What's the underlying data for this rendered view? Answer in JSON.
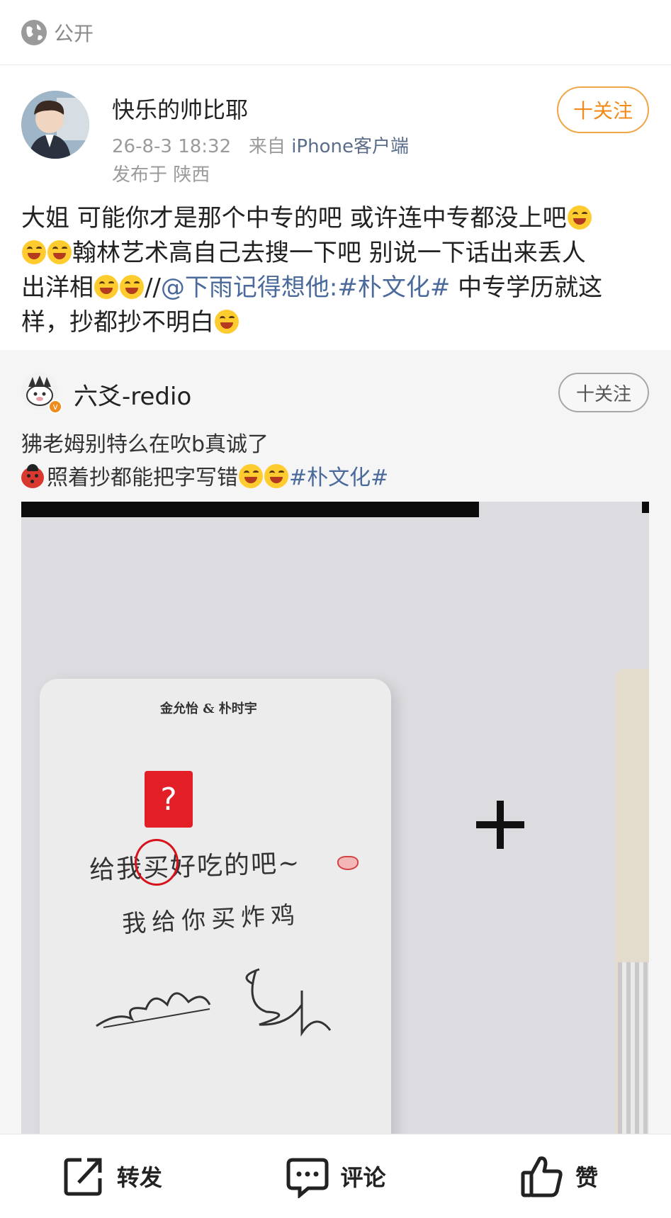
{
  "visibility": {
    "label": "公开",
    "icon": "globe-icon"
  },
  "author": {
    "name": "快乐的帅比耶",
    "time": "26-8-3 18:32",
    "source_prefix": "来自",
    "source": "iPhone客户端",
    "location": "发布于 陕西",
    "follow_label": "十关注"
  },
  "post": {
    "line1": "大姐 可能你才是那个中专的吧 或许连中专都没上吧",
    "line2": "翰林艺术高自己去搜一下吧 别说一下话出来丢人",
    "line3_start": "出洋相",
    "line3_sep": "//",
    "mention": "@下雨记得想他:",
    "topic": "#朴文化#",
    "line3_end": " 中专学历就这",
    "line4": "样，抄都抄不明白",
    "emoji_name": "laugh-cry-emoji"
  },
  "repost": {
    "author_name": "六爻-redio",
    "verified_badge": "v",
    "follow_label": "十关注",
    "line1": "狒老姆别特么在吹b真诚了",
    "line2": "照着抄都能把字写错",
    "topic": "#朴文化#",
    "image": {
      "card_title": "金允怡 & 朴时宇",
      "question_mark": "?",
      "handwriting_line1": "给我买好吃的吧~",
      "handwriting_line2": "我给你买炸鸡"
    }
  },
  "actions": {
    "repost_label": "转发",
    "comment_label": "评论",
    "like_label": "赞"
  },
  "colors": {
    "accent_orange": "#f08c1b",
    "link_blue": "#4a6a9c",
    "muted_gray": "#9b9b9b"
  }
}
